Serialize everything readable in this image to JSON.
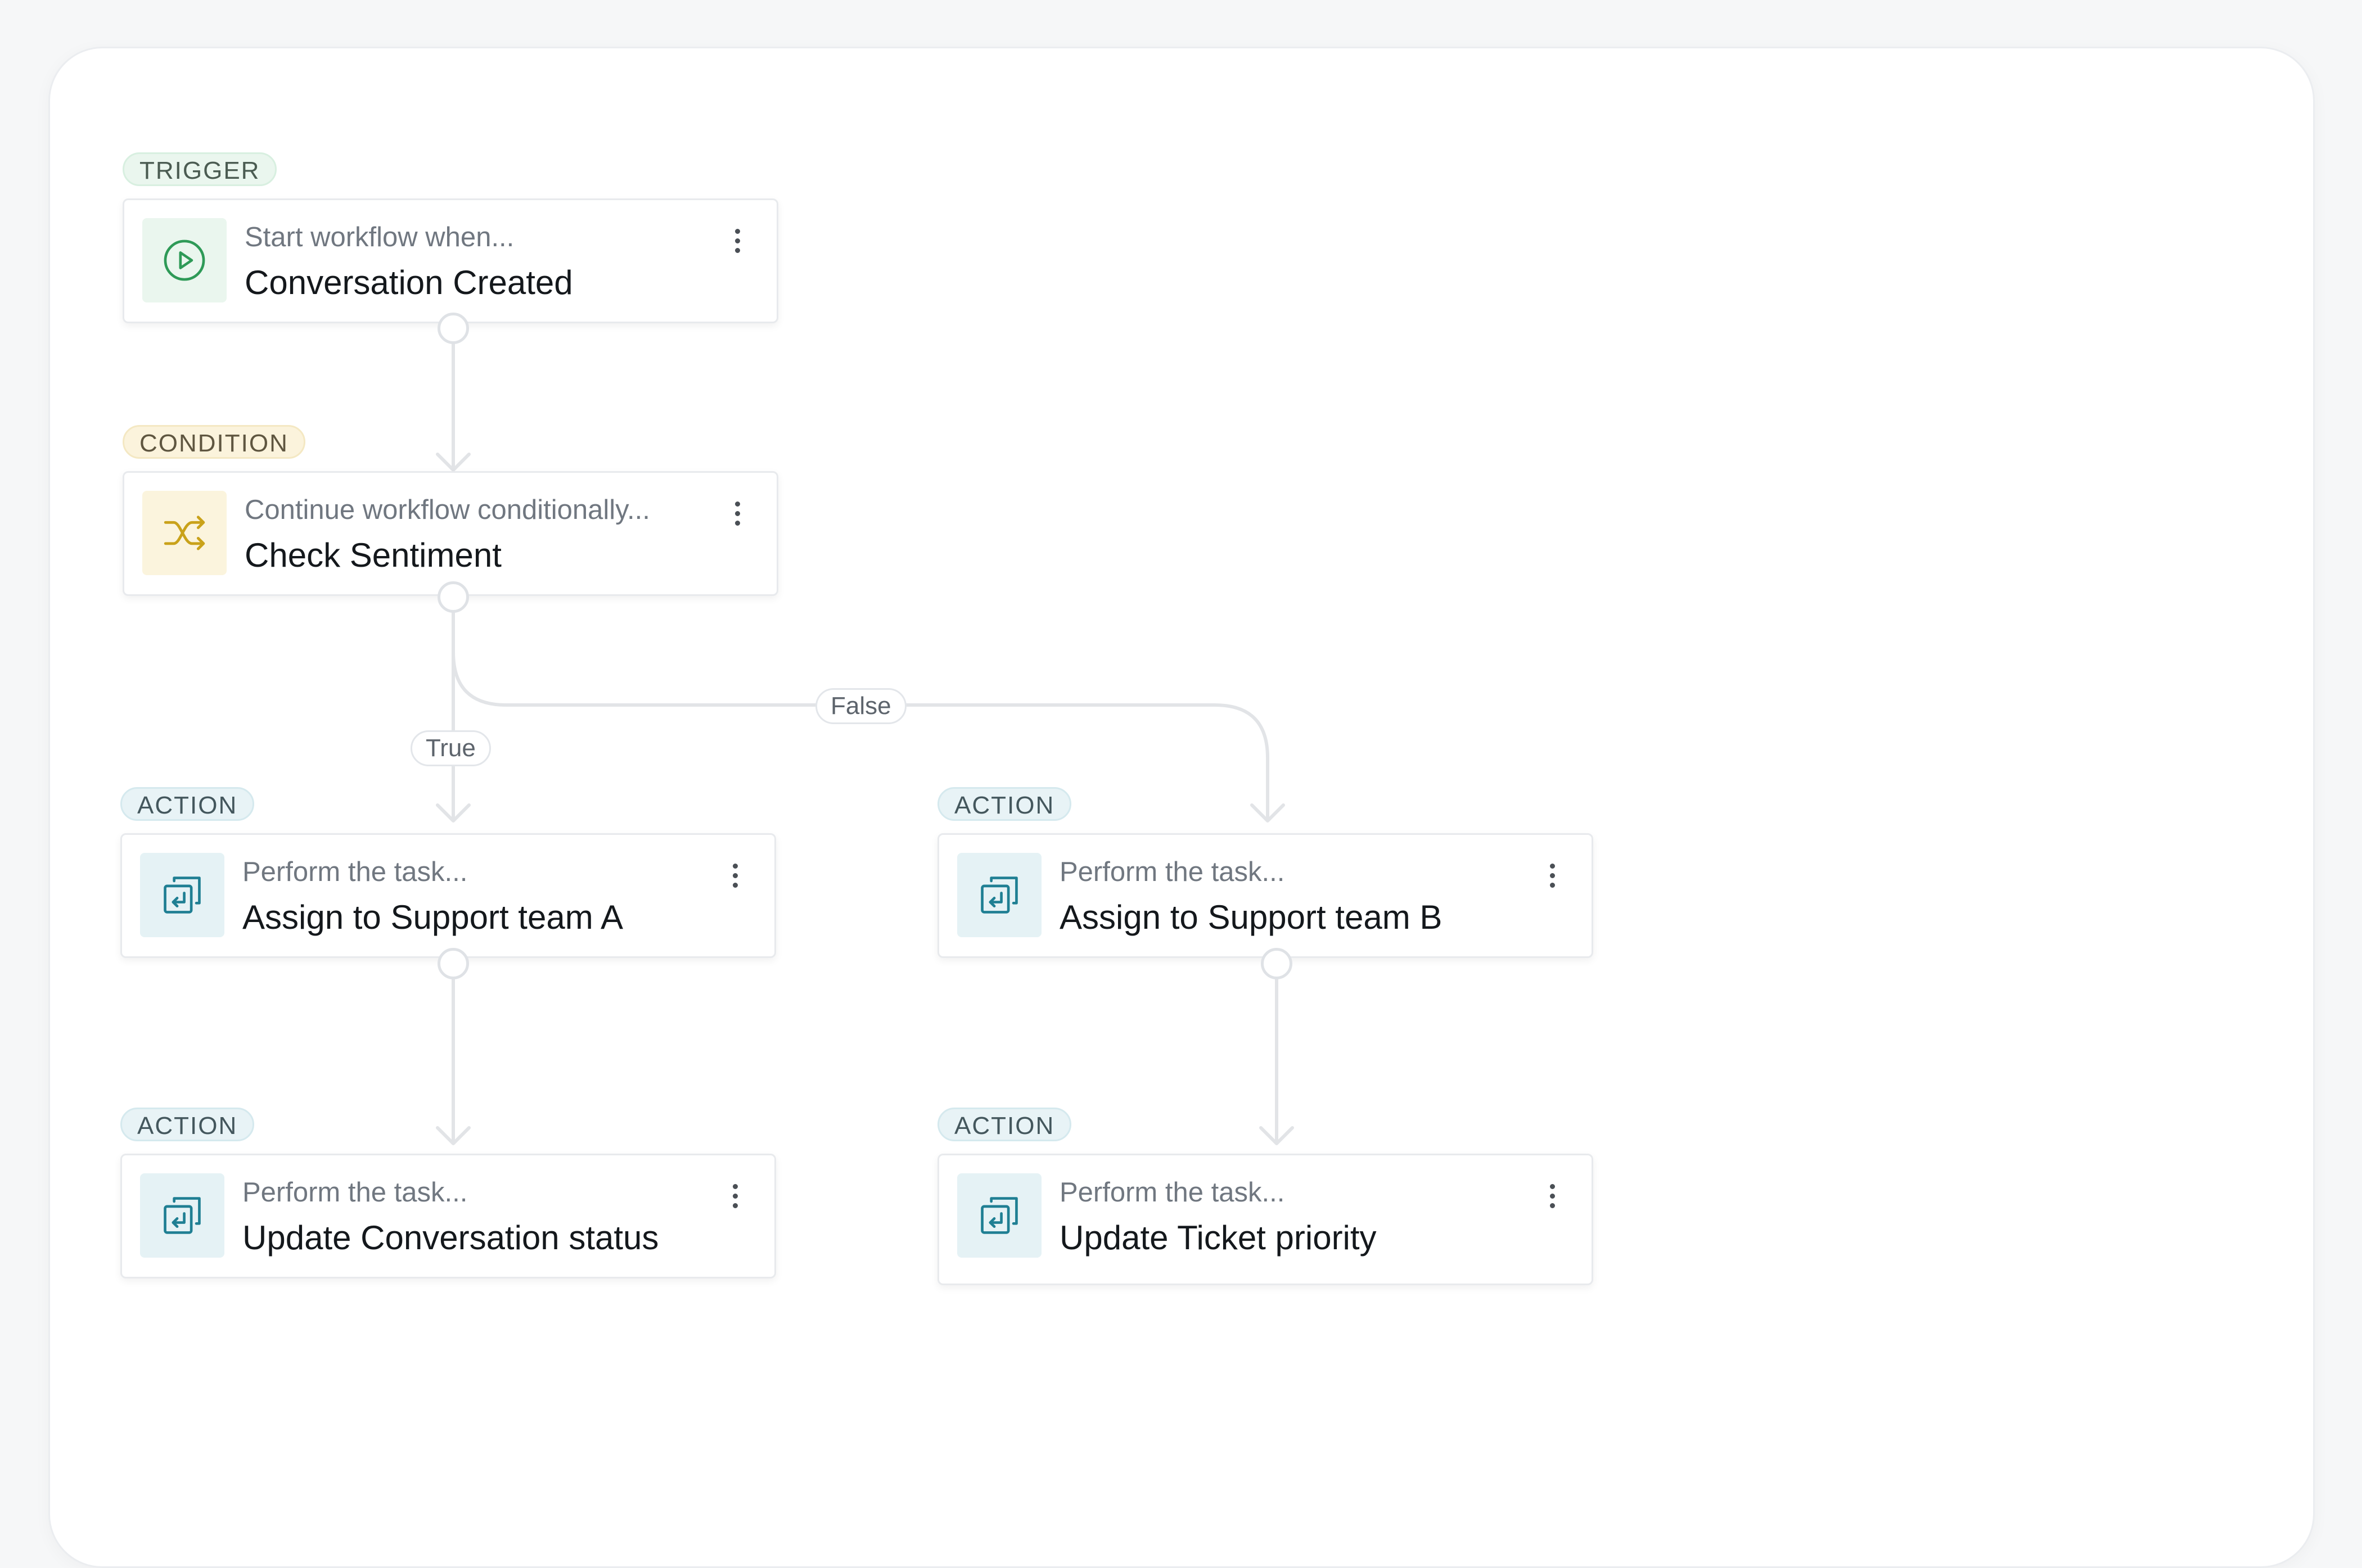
{
  "nodes": {
    "trigger": {
      "tag": "TRIGGER",
      "subtitle": "Start workflow when...",
      "title": "Conversation Created",
      "icon": "play-circle-icon"
    },
    "condition": {
      "tag": "CONDITION",
      "subtitle": "Continue workflow conditionally...",
      "title": "Check Sentiment",
      "icon": "shuffle-icon"
    },
    "action_a": {
      "tag": "ACTION",
      "subtitle": "Perform the task...",
      "title": "Assign to Support team A",
      "icon": "assign-return-icon"
    },
    "action_b": {
      "tag": "ACTION",
      "subtitle": "Perform the task...",
      "title": "Assign to Support team B",
      "icon": "assign-return-icon"
    },
    "action_c": {
      "tag": "ACTION",
      "subtitle": "Perform the task...",
      "title": "Update Conversation status",
      "icon": "assign-return-icon"
    },
    "action_d": {
      "tag": "ACTION",
      "subtitle": "Perform the task...",
      "title": "Update Ticket priority",
      "icon": "assign-return-icon"
    }
  },
  "edges": {
    "true_label": "True",
    "false_label": "False"
  },
  "colors": {
    "trigger_accent": "#2e9a57",
    "condition_accent": "#c9a21a",
    "action_accent": "#1f7f93",
    "wire": "#e2e4e7"
  }
}
